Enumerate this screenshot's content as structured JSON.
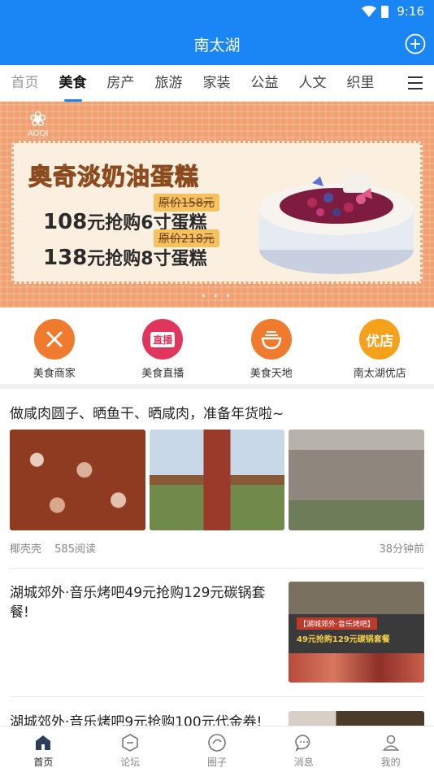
{
  "status_bar": {
    "time": "9:16"
  },
  "header": {
    "title": "南太湖"
  },
  "tabs": [
    {
      "label": "首页"
    },
    {
      "label": "美食"
    },
    {
      "label": "房产"
    },
    {
      "label": "旅游"
    },
    {
      "label": "家装"
    },
    {
      "label": "公益"
    },
    {
      "label": "人文"
    },
    {
      "label": "织里"
    }
  ],
  "active_tab": "美食",
  "banner": {
    "logo_text": "AOQI",
    "headline": "奥奇淡奶油蛋糕",
    "offers": [
      {
        "original": "原价158元",
        "price": "108",
        "text": "元抢购6寸蛋糕"
      },
      {
        "original": "原价218元",
        "price": "138",
        "text": "元抢购8寸蛋糕"
      }
    ],
    "indicator": "• • •"
  },
  "quick_links": [
    {
      "label": "美食商家",
      "icon": "fork-knife-icon",
      "color": "#f07a2e"
    },
    {
      "label": "美食直播",
      "icon": "live-tv-icon",
      "color": "#e0365e",
      "icon_text": "直播"
    },
    {
      "label": "美食天地",
      "icon": "noodle-bowl-icon",
      "color": "#f07a2e"
    },
    {
      "label": "南太湖优店",
      "icon": "store-icon",
      "color": "#f5a11c",
      "icon_text": "优店"
    }
  ],
  "feed": {
    "post1": {
      "title": "做咸肉圆子、晒鱼干、晒咸肉，准备年货啦~",
      "author": "椰壳壳",
      "reads": "585阅读",
      "time": "38分钟前"
    },
    "post2": {
      "title": "湖城郊外·音乐烤吧49元抢购129元碳锅套餐!",
      "thumb_caption_top": "【湖城郊外·音乐烤吧】",
      "thumb_caption_price": "49元抢购129元碳锅套餐"
    },
    "post3": {
      "title": "湖城郊外·音乐烤吧9元抢购100元代金券!"
    }
  },
  "bottom_nav": [
    {
      "label": "首页",
      "icon": "home-icon"
    },
    {
      "label": "论坛",
      "icon": "forum-icon"
    },
    {
      "label": "圈子",
      "icon": "circle-icon"
    },
    {
      "label": "消息",
      "icon": "message-icon"
    },
    {
      "label": "我的",
      "icon": "user-icon"
    }
  ],
  "colors": {
    "brand": "#1a86f5",
    "banner": "#f0a071"
  }
}
